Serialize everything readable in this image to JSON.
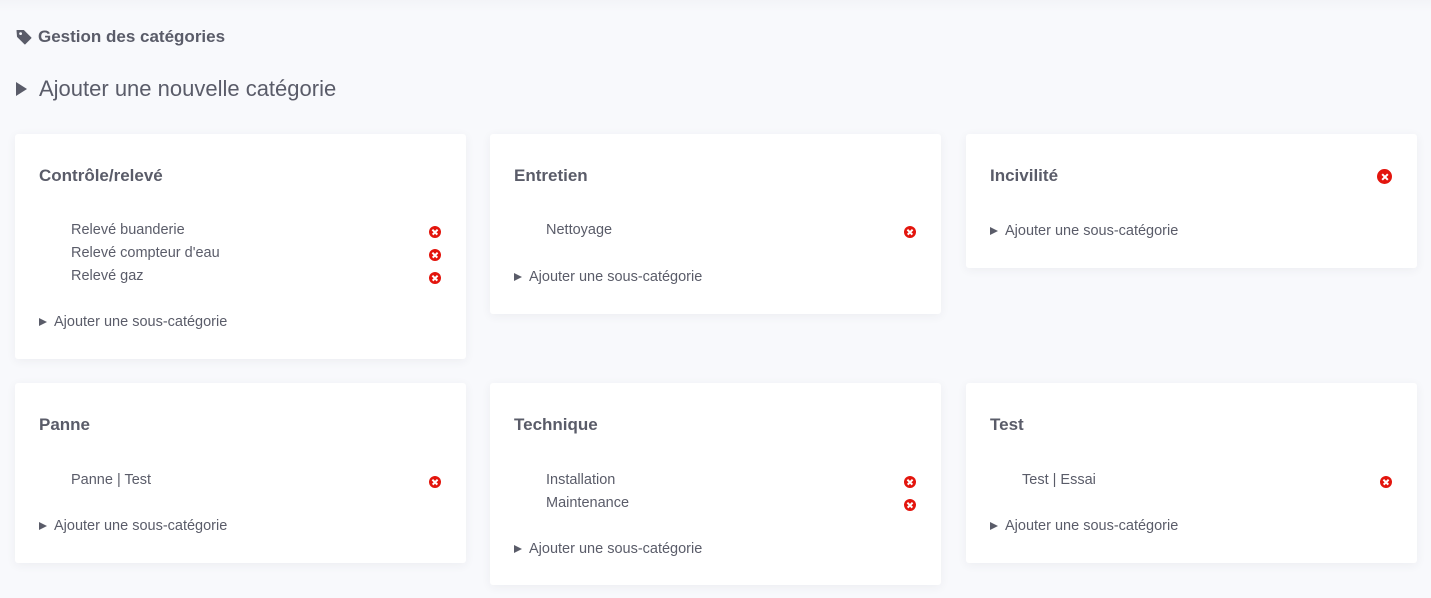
{
  "header": {
    "title": "Gestion des catégories",
    "icon": "tag-icon"
  },
  "add_category": {
    "label": "Ajouter une nouvelle catégorie"
  },
  "colors": {
    "delete": "#e3150d",
    "text": "#5a5c69",
    "background": "#f8f9fc",
    "card": "#ffffff"
  },
  "add_subcategory_label": "Ajouter une sous-catégorie",
  "categories": [
    {
      "title": "Contrôle/relevé",
      "deletable": false,
      "subcategories": [
        "Relevé buanderie",
        "Relevé compteur d'eau",
        "Relevé gaz"
      ]
    },
    {
      "title": "Entretien",
      "deletable": false,
      "subcategories": [
        "Nettoyage"
      ]
    },
    {
      "title": "Incivilité",
      "deletable": true,
      "subcategories": []
    },
    {
      "title": "Panne",
      "deletable": false,
      "subcategories": [
        "Panne | Test"
      ]
    },
    {
      "title": "Technique",
      "deletable": false,
      "subcategories": [
        "Installation",
        "Maintenance"
      ]
    },
    {
      "title": "Test",
      "deletable": false,
      "subcategories": [
        "Test | Essai"
      ]
    }
  ]
}
